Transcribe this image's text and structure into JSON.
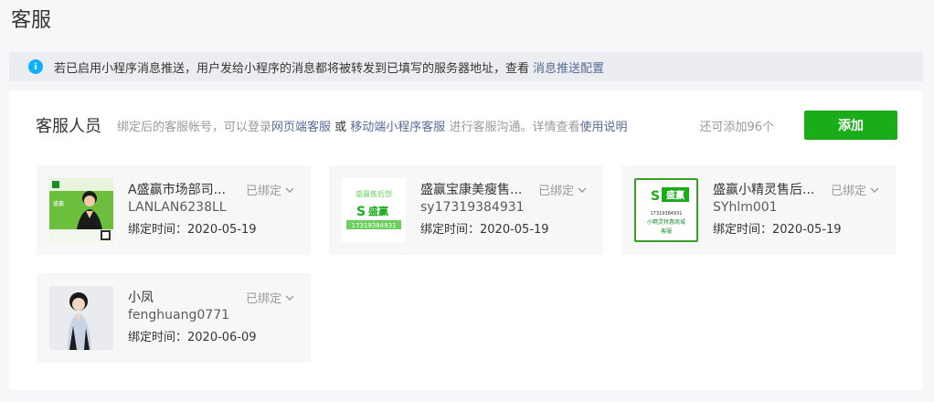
{
  "page_title": "客服",
  "notice": {
    "text": "若已启用小程序消息推送，用户发给小程序的消息都将被转发到已填写的服务器地址，查看",
    "link": "消息推送配置",
    "icon": "info-icon"
  },
  "panel": {
    "title": "客服人员",
    "desc_prefix": "绑定后的客服帐号，可以登录",
    "desc_link1": "网页端客服",
    "desc_mid": " 或 ",
    "desc_link2": "移动端小程序客服",
    "desc_suffix": " 进行客服沟通。详情查看",
    "desc_link3": "使用说明",
    "remaining": "还可添加96个",
    "add_label": "添加"
  },
  "bind_time_label": "绑定时间：",
  "cards": [
    {
      "name": "A盛赢市场部司...",
      "status": "已绑定",
      "account": "LANLAN6238LL",
      "bind_date": "2020-05-19"
    },
    {
      "name": "盛赢宝康美瘦售...",
      "status": "已绑定",
      "account": "sy17319384931",
      "bind_date": "2020-05-19"
    },
    {
      "name": "盛赢小精灵售后...",
      "status": "已绑定",
      "account": "SYhlm001",
      "bind_date": "2020-05-19"
    },
    {
      "name": "小凤",
      "status": "已绑定",
      "account": "fenghuang0771",
      "bind_date": "2020-06-09"
    }
  ],
  "colors": {
    "accent_green": "#1aad19",
    "link_blue": "#576b95",
    "info_blue": "#10aeff"
  }
}
